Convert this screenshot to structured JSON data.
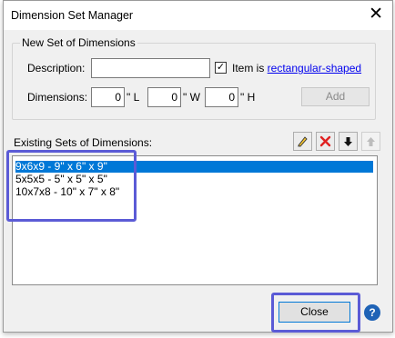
{
  "window": {
    "title": "Dimension Set Manager",
    "close_glyph": "✕"
  },
  "new_set": {
    "legend": "New Set of Dimensions",
    "description_label": "Description:",
    "description_value": "",
    "checkbox_checked": true,
    "checkbox_glyph": "✓",
    "item_is_text": "Item is ",
    "item_is_link": "rectangular-shaped",
    "dimensions_label": "Dimensions:",
    "length_value": "0",
    "length_unit": "\" L",
    "width_value": "0",
    "width_unit": "\" W",
    "height_value": "0",
    "height_unit": "\" H",
    "add_label": "Add"
  },
  "existing": {
    "label": "Existing Sets of Dimensions:",
    "toolbar": {
      "edit_icon": "pencil-icon",
      "delete_icon": "red-x-icon",
      "move_down_icon": "arrow-down-icon",
      "move_up_icon": "arrow-up-icon"
    },
    "items": [
      {
        "text": "9x6x9 - 9\" x 6\" x 9\"",
        "selected": true
      },
      {
        "text": "5x5x5 - 5\" x 5\" x 5\"",
        "selected": false
      },
      {
        "text": "10x7x8 - 10\" x 7\" x 8\"",
        "selected": false
      }
    ]
  },
  "footer": {
    "close_label": "Close",
    "help_glyph": "?"
  },
  "colors": {
    "highlight": "#5b5bd6",
    "selection": "#0078d7",
    "link": "#0000ee",
    "delete_red": "#e02020"
  }
}
